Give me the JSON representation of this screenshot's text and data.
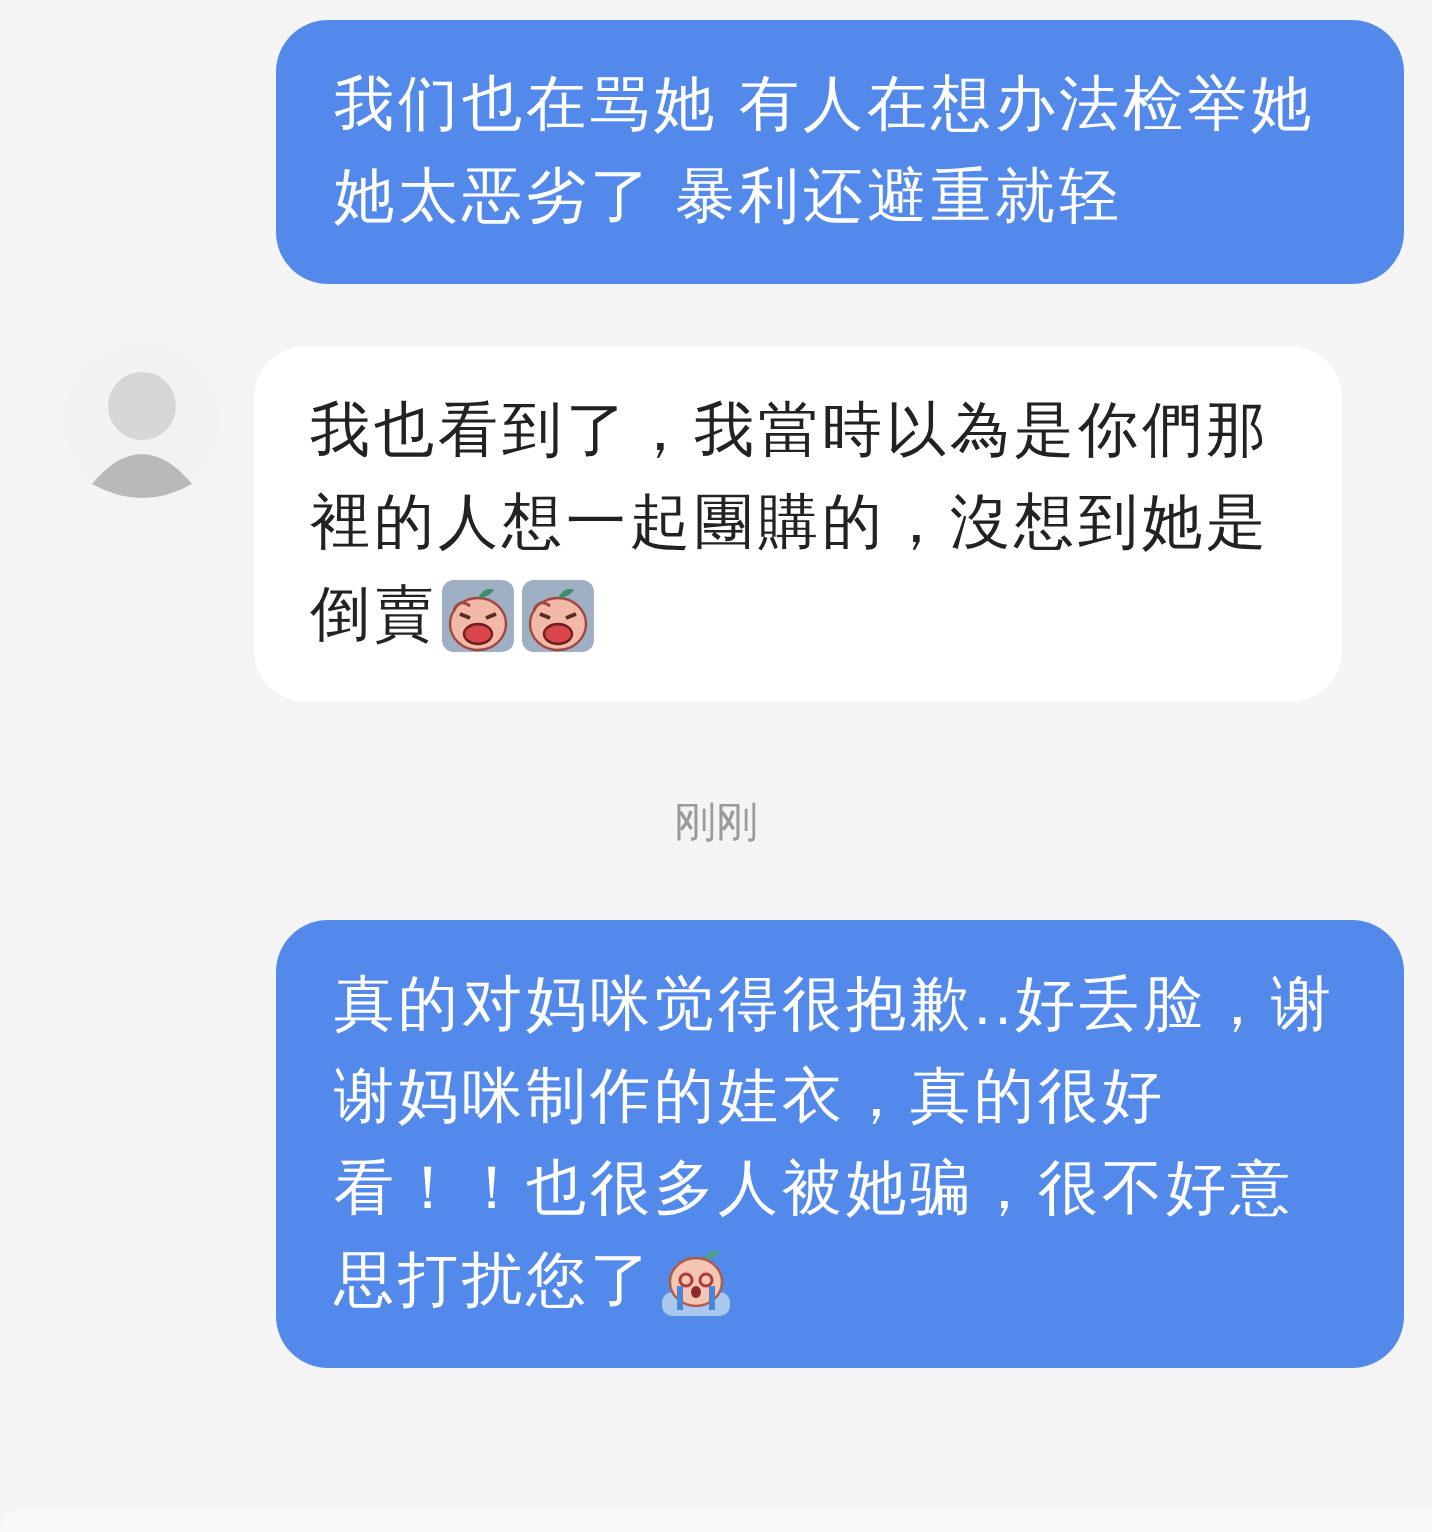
{
  "messages": [
    {
      "kind": "sent",
      "lines": [
        "我们也在骂她 有人在想办法检举她",
        "她太恶劣了 暴利还避重就轻"
      ]
    },
    {
      "kind": "received",
      "lines": [
        "我也看到了，我當時以為是你們那",
        "裡的人想一起團購的，沒想到她是",
        "倒賣"
      ],
      "stickers": [
        {
          "kind": "wail"
        },
        {
          "kind": "wail"
        }
      ]
    },
    {
      "kind": "time",
      "text": "刚刚"
    },
    {
      "kind": "sent",
      "lines": [
        "真的对妈咪觉得很抱歉..好丢脸，谢",
        "谢妈咪制作的娃衣，真的很好",
        "看！！也很多人被她骗，很不好意",
        "思打扰您了"
      ],
      "stickers": [
        {
          "kind": "sob"
        }
      ]
    }
  ]
}
